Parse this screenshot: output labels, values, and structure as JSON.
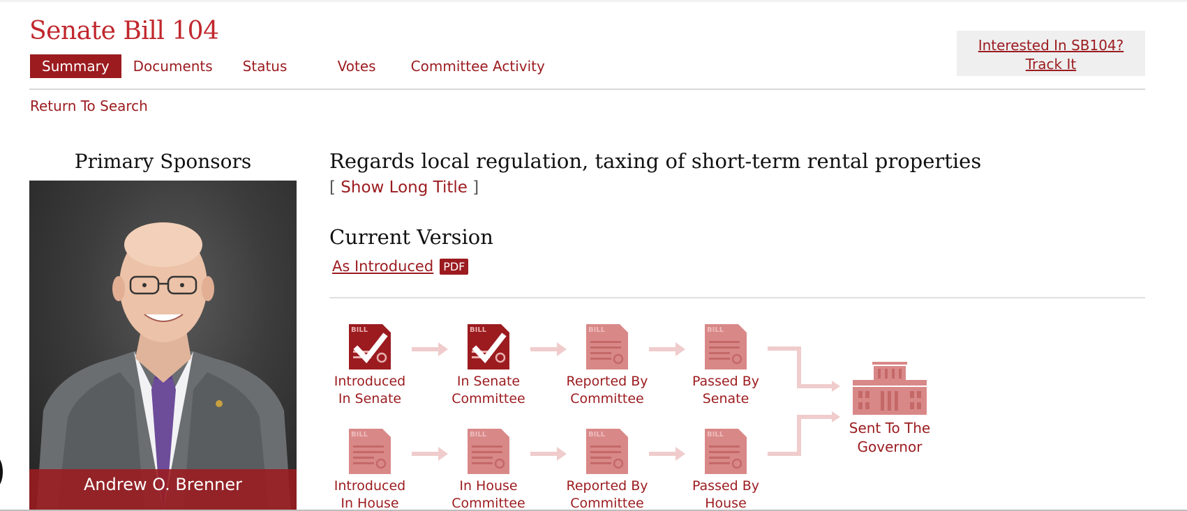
{
  "bill": {
    "title": "Senate Bill 104",
    "short_title": "Regards local regulation, taxing of short-term rental properties",
    "show_long_title_label": "Show Long Title",
    "bracket_open": "[",
    "bracket_close": "]"
  },
  "tabs": [
    {
      "label": "Summary",
      "active": true
    },
    {
      "label": "Documents",
      "active": false
    },
    {
      "label": "Status",
      "active": false
    },
    {
      "label": "Votes",
      "active": false
    },
    {
      "label": "Committee Activity",
      "active": false
    }
  ],
  "track": {
    "line1": "Interested In SB104?",
    "line2": "Track It"
  },
  "return_label": "Return To Search",
  "sponsors": {
    "heading": "Primary Sponsors",
    "name": "Andrew O. Brenner"
  },
  "current_version": {
    "heading": "Current Version",
    "link_label": "As Introduced",
    "badge": "PDF"
  },
  "status_flow": {
    "senate_row": [
      {
        "line1": "Introduced",
        "line2": "In Senate",
        "completed": true
      },
      {
        "line1": "In Senate",
        "line2": "Committee",
        "completed": true
      },
      {
        "line1": "Reported By",
        "line2": "Committee",
        "completed": false
      },
      {
        "line1": "Passed By",
        "line2": "Senate",
        "completed": false
      }
    ],
    "house_row": [
      {
        "line1": "Introduced",
        "line2": "In House",
        "completed": false
      },
      {
        "line1": "In House",
        "line2": "Committee",
        "completed": false
      },
      {
        "line1": "Reported By",
        "line2": "Committee",
        "completed": false
      },
      {
        "line1": "Passed By",
        "line2": "House",
        "completed": false
      }
    ],
    "final": {
      "line1": "Sent To The",
      "line2": "Governor",
      "completed": false
    },
    "icon_text": "BILL"
  },
  "colors": {
    "accent": "#9b1b1f",
    "title_red": "#c0272d",
    "pending": "#d98888",
    "arrow": "#f0cccc"
  }
}
